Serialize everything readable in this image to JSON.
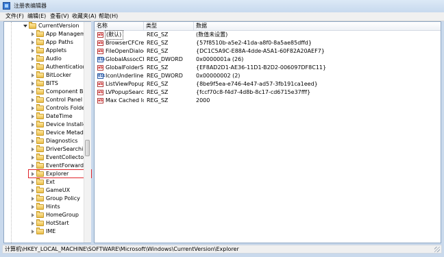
{
  "window": {
    "title": "注册表编辑器"
  },
  "menu": [
    "文件(F)",
    "编辑(E)",
    "查看(V)",
    "收藏夹(A)",
    "帮助(H)"
  ],
  "tree": {
    "parent": "CurrentVersion",
    "items": [
      "App Management",
      "App Paths",
      "Applets",
      "Audio",
      "Authentication",
      "BitLocker",
      "BITS",
      "Component Based",
      "Control Panel",
      "Controls Folder",
      "DateTime",
      "Device Installer",
      "Device Metadata",
      "Diagnostics",
      "DriverSearching",
      "EventCollector",
      "EventForwarding",
      "Explorer",
      "Ext",
      "GameUX",
      "Group Policy",
      "Hints",
      "HomeGroup",
      "HotStart",
      "IME"
    ],
    "selected": "Explorer"
  },
  "columns": {
    "name": "名称",
    "type": "类型",
    "data": "数据"
  },
  "values": [
    {
      "icon": "string-value-icon",
      "name": "(默认)",
      "type": "REG_SZ",
      "data": "(数值未设置)"
    },
    {
      "icon": "string-value-icon",
      "name": "BrowserCFCre...",
      "type": "REG_SZ",
      "data": "{57f8510b-a5e2-41da-a8f0-8a5ae85dffd}"
    },
    {
      "icon": "string-value-icon",
      "name": "FileOpenDialog",
      "type": "REG_SZ",
      "data": "{DC1C5A9C-E88A-4dde-A5A1-60F82A20AEF7}"
    },
    {
      "icon": "dword-value-icon",
      "name": "GlobalAssocCh...",
      "type": "REG_DWORD",
      "data": "0x0000001a (26)"
    },
    {
      "icon": "string-value-icon",
      "name": "GlobalFolderS...",
      "type": "REG_SZ",
      "data": "{EF8AD2D1-AE36-11D1-B2D2-006097DF8C11}"
    },
    {
      "icon": "dword-value-icon",
      "name": "IconUnderline",
      "type": "REG_DWORD",
      "data": "0x00000002 (2)"
    },
    {
      "icon": "string-value-icon",
      "name": "ListViewPopup...",
      "type": "REG_SZ",
      "data": "{8be9f5ea-e746-4e47-ad57-3fb191ca1eed}"
    },
    {
      "icon": "string-value-icon",
      "name": "LVPopupSearc...",
      "type": "REG_SZ",
      "data": "{fccf70c8-f4d7-4d8b-8c17-cd6715e37fff}"
    },
    {
      "icon": "string-value-icon",
      "name": "Max Cached Ic...",
      "type": "REG_SZ",
      "data": "2000"
    }
  ],
  "status": {
    "path": "计算机\\HKEY_LOCAL_MACHINE\\SOFTWARE\\Microsoft\\Windows\\CurrentVersion\\Explorer"
  }
}
